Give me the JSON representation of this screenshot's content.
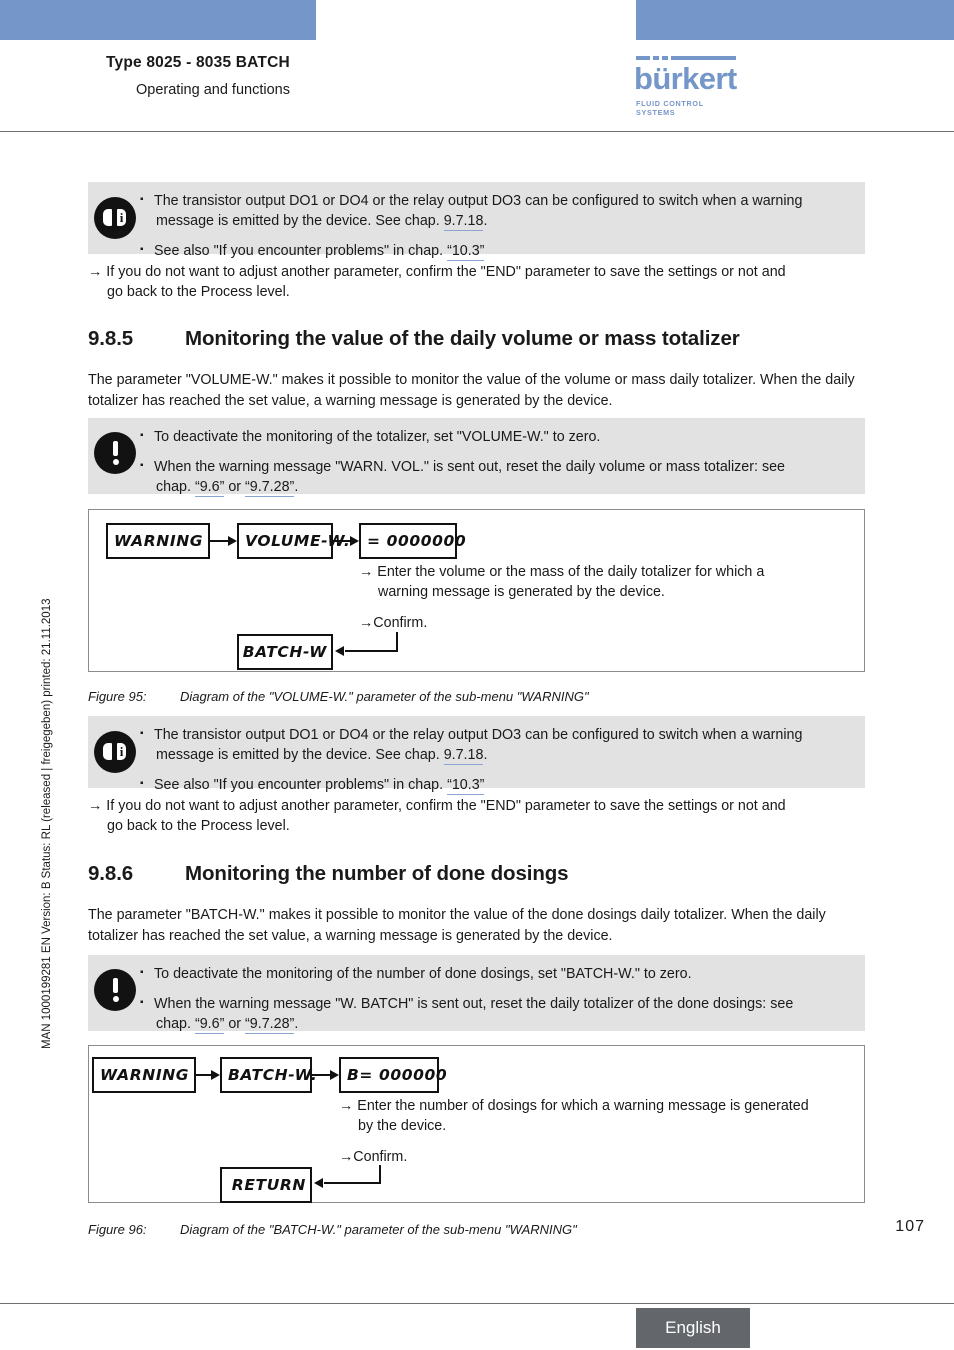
{
  "header": {
    "title": "Type 8025 - 8035 BATCH",
    "subtitle": "Operating and functions",
    "logo_word": "bürkert",
    "logo_tagline": "FLUID CONTROL SYSTEMS"
  },
  "side_imprint": "MAN 1000199281  EN  Version: B  Status: RL (released | freigegeben)  printed: 21.11.2013",
  "note_top": {
    "icon": "info-icon",
    "items": [
      {
        "line1": "The transistor output DO1 or DO4 or the relay output DO3 can be configured to switch when a warning",
        "line2_pre": "message is emitted by the device. See chap. ",
        "line2_ref": "9.7.18",
        "line2_post": "."
      },
      {
        "line1_pre": "See also \"If you encounter problems\" in chap. ",
        "line1_ref": "“10.3”",
        "line1_post": ""
      }
    ]
  },
  "arrow_top": {
    "arrow": "→",
    "line1": "If you do not want to adjust another parameter, confirm the \"END\" parameter to save the settings or not and",
    "line2": "go back to the Process level."
  },
  "section_985": {
    "number": "9.8.5",
    "title": "Monitoring the value of the daily volume or mass totalizer",
    "para_line1": "The parameter \"VOLUME-W.\" makes it possible to monitor the value of the volume or mass daily totalizer. When",
    "para_line2": "the daily totalizer has reached the set value, a warning message is generated by the device."
  },
  "warn_985": {
    "icon": "warning-icon",
    "items": [
      {
        "line1": "To deactivate the monitoring of the totalizer, set \"VOLUME-W.\" to zero."
      },
      {
        "line1": "When the warning message \"WARN. VOL.\" is sent out, reset the daily volume or mass totalizer: see",
        "line2_pre": "chap. ",
        "line2_ref1": "“9.6”",
        "line2_mid": " or ",
        "line2_ref2": "“9.7.28”",
        "line2_post": "."
      }
    ]
  },
  "figure_95": {
    "lcd_warning": "WARNING",
    "lcd_param": "VOLUME-W.",
    "lcd_value": "= 0000000",
    "lcd_next": "BATCH-W",
    "note_enter_line1": "Enter the volume or the mass of the daily totalizer for which a",
    "note_enter_line2": "warning message is generated by the device.",
    "note_confirm": "Confirm.",
    "arrow": "→",
    "caption_num": "Figure 95:",
    "caption_text": "Diagram of the \"VOLUME-W.\" parameter of the sub-menu \"WARNING\""
  },
  "note_mid": {
    "icon": "info-icon",
    "items": [
      {
        "line1": "The transistor output DO1 or DO4 or the relay output DO3 can be configured to switch when a warning",
        "line2_pre": "message is emitted by the device. See chap. ",
        "line2_ref": "9.7.18",
        "line2_post": "."
      },
      {
        "line1_pre": "See also \"If you encounter problems\" in chap. ",
        "line1_ref": "“10.3”",
        "line1_post": ""
      }
    ]
  },
  "arrow_mid": {
    "arrow": "→",
    "line1": "If you do not want to adjust another parameter, confirm the \"END\" parameter to save the settings or not and",
    "line2": "go back to the Process level."
  },
  "section_986": {
    "number": "9.8.6",
    "title": "Monitoring the number of done dosings",
    "para_line1": "The parameter \"BATCH-W.\" makes it possible to monitor the value of the done dosings daily totalizer. When the",
    "para_line2": "daily totalizer has reached the set value, a warning message is generated by the device."
  },
  "warn_986": {
    "icon": "warning-icon",
    "items": [
      {
        "line1": "To deactivate the monitoring of the number of done dosings, set \"BATCH-W.\" to zero."
      },
      {
        "line1": "When the warning message \"W. BATCH\" is sent out, reset the daily totalizer of the done dosings: see",
        "line2_pre": "chap. ",
        "line2_ref1": "“9.6”",
        "line2_mid": " or ",
        "line2_ref2": "“9.7.28”",
        "line2_post": "."
      }
    ]
  },
  "figure_96": {
    "lcd_warning": "WARNING",
    "lcd_param": "BATCH-W.",
    "lcd_value": "B= 000000",
    "lcd_next": "RETURN",
    "note_enter_line1": "Enter the number of dosings for which a warning message is generated",
    "note_enter_line2": "by the device.",
    "note_confirm": "Confirm.",
    "arrow": "→",
    "caption_num": "Figure 96:",
    "caption_text": "Diagram of the \"BATCH-W.\" parameter of the sub-menu \"WARNING\""
  },
  "page_number": "107",
  "footer": {
    "language": "English"
  },
  "colors": {
    "accent_blue": "#7596c9",
    "note_bg": "#e2e2e2",
    "footer_gray": "#63666b",
    "xref_underline": "#8aa6d0"
  }
}
